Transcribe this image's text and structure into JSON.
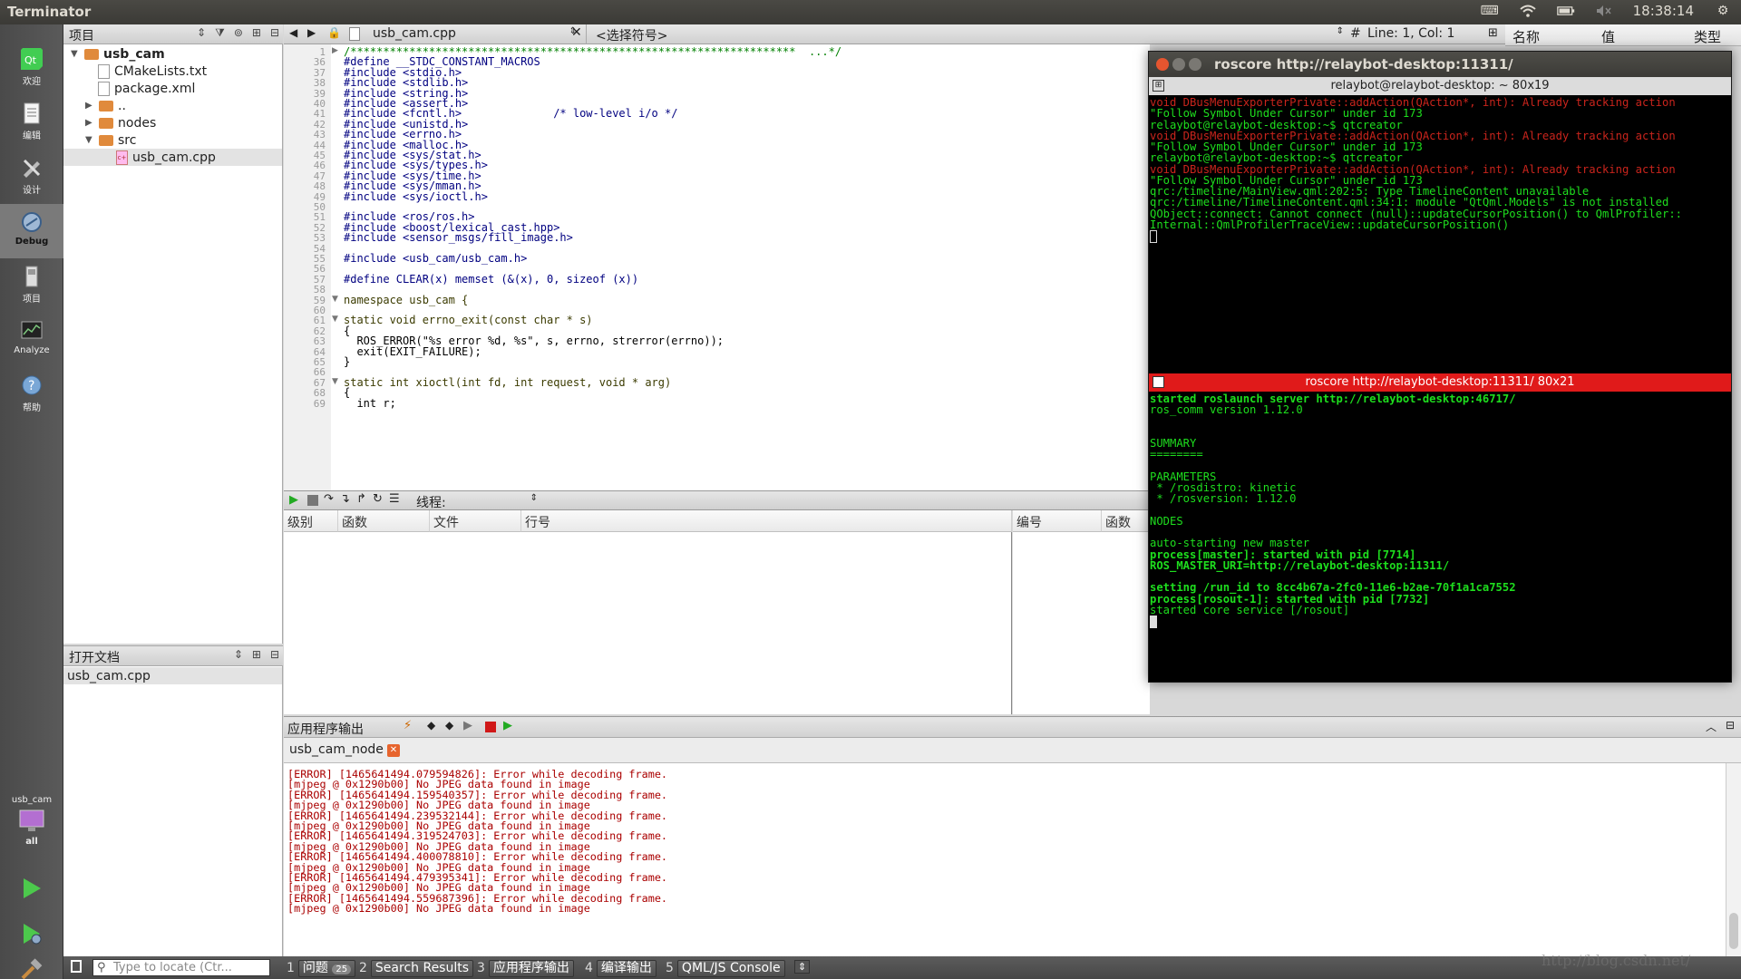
{
  "topbar": {
    "app_title": "Terminator",
    "time": "18:38:14"
  },
  "modebar": {
    "modes": [
      {
        "label": "欢迎"
      },
      {
        "label": "编辑"
      },
      {
        "label": "设计"
      },
      {
        "label": "Debug"
      },
      {
        "label": "项目"
      },
      {
        "label": "Analyze"
      },
      {
        "label": "帮助"
      }
    ],
    "kit_project": "usb_cam",
    "kit_build": "all"
  },
  "project_panel": {
    "title": "项目",
    "tree": [
      {
        "label": "usb_cam"
      },
      {
        "label": "CMakeLists.txt"
      },
      {
        "label": "package.xml"
      },
      {
        "label": ".."
      },
      {
        "label": "nodes"
      },
      {
        "label": "src"
      },
      {
        "label": "usb_cam.cpp"
      }
    ]
  },
  "open_docs": {
    "title": "打开文档",
    "items": [
      "usb_cam.cpp"
    ]
  },
  "editor": {
    "file_name": "usb_cam.cpp",
    "symbol_placeholder": "<选择符号>",
    "cursor_pos": "Line: 1, Col: 1",
    "encoding_mark": "#"
  },
  "code_lines": [
    {
      "n": "1",
      "t": "/********************************************************************  ...*/"
    },
    {
      "n": "36",
      "t": "#define __STDC_CONSTANT_MACROS"
    },
    {
      "n": "37",
      "t": "#include <stdio.h>"
    },
    {
      "n": "38",
      "t": "#include <stdlib.h>"
    },
    {
      "n": "39",
      "t": "#include <string.h>"
    },
    {
      "n": "40",
      "t": "#include <assert.h>"
    },
    {
      "n": "41",
      "t": "#include <fcntl.h>              /* low-level i/o */"
    },
    {
      "n": "42",
      "t": "#include <unistd.h>"
    },
    {
      "n": "43",
      "t": "#include <errno.h>"
    },
    {
      "n": "44",
      "t": "#include <malloc.h>"
    },
    {
      "n": "45",
      "t": "#include <sys/stat.h>"
    },
    {
      "n": "46",
      "t": "#include <sys/types.h>"
    },
    {
      "n": "47",
      "t": "#include <sys/time.h>"
    },
    {
      "n": "48",
      "t": "#include <sys/mman.h>"
    },
    {
      "n": "49",
      "t": "#include <sys/ioctl.h>"
    },
    {
      "n": "50",
      "t": ""
    },
    {
      "n": "51",
      "t": "#include <ros/ros.h>"
    },
    {
      "n": "52",
      "t": "#include <boost/lexical_cast.hpp>"
    },
    {
      "n": "53",
      "t": "#include <sensor_msgs/fill_image.h>"
    },
    {
      "n": "54",
      "t": ""
    },
    {
      "n": "55",
      "t": "#include <usb_cam/usb_cam.h>"
    },
    {
      "n": "56",
      "t": ""
    },
    {
      "n": "57",
      "t": "#define CLEAR(x) memset (&(x), 0, sizeof (x))"
    },
    {
      "n": "58",
      "t": ""
    },
    {
      "n": "59",
      "t": "namespace usb_cam {"
    },
    {
      "n": "60",
      "t": ""
    },
    {
      "n": "61",
      "t": "static void errno_exit(const char * s)"
    },
    {
      "n": "62",
      "t": "{"
    },
    {
      "n": "63",
      "t": "  ROS_ERROR(\"%s error %d, %s\", s, errno, strerror(errno));"
    },
    {
      "n": "64",
      "t": "  exit(EXIT_FAILURE);"
    },
    {
      "n": "65",
      "t": "}"
    },
    {
      "n": "66",
      "t": ""
    },
    {
      "n": "67",
      "t": "static int xioctl(int fd, int request, void * arg)"
    },
    {
      "n": "68",
      "t": "{"
    },
    {
      "n": "69",
      "t": "  int r;"
    }
  ],
  "debugger": {
    "thread_label": "线程:",
    "stack_columns": [
      "级别",
      "函数",
      "文件",
      "行号"
    ],
    "bp_columns": [
      "编号",
      "函数"
    ]
  },
  "locals": {
    "columns": [
      "名称",
      "值",
      "类型"
    ]
  },
  "output": {
    "title": "应用程序输出",
    "tab": "usb_cam_node",
    "lines": [
      "[ERROR] [1465641494.079594826]: Error while decoding frame.",
      "[mjpeg @ 0x1290b00] No JPEG data found in image",
      "[ERROR] [1465641494.159540357]: Error while decoding frame.",
      "[mjpeg @ 0x1290b00] No JPEG data found in image",
      "[ERROR] [1465641494.239532144]: Error while decoding frame.",
      "[mjpeg @ 0x1290b00] No JPEG data found in image",
      "[ERROR] [1465641494.319524703]: Error while decoding frame.",
      "[mjpeg @ 0x1290b00] No JPEG data found in image",
      "[ERROR] [1465641494.400078810]: Error while decoding frame.",
      "[mjpeg @ 0x1290b00] No JPEG data found in image",
      "[ERROR] [1465641494.479395341]: Error while decoding frame.",
      "[mjpeg @ 0x1290b00] No JPEG data found in image",
      "[ERROR] [1465641494.559687396]: Error while decoding frame.",
      "[mjpeg @ 0x1290b00] No JPEG data found in image"
    ]
  },
  "bottombar": {
    "locate_placeholder": "Type to locate (Ctr...",
    "tabs": [
      {
        "num": "1",
        "label": "问题",
        "badge": "25"
      },
      {
        "num": "2",
        "label": "Search Results"
      },
      {
        "num": "3",
        "label": "应用程序输出"
      },
      {
        "num": "4",
        "label": "编译输出"
      },
      {
        "num": "5",
        "label": "QML/JS Console"
      }
    ]
  },
  "terminal": {
    "window_title": "roscore http://relaybot-desktop:11311/",
    "pane1_title": "relaybot@relaybot-desktop: ~ 80x19",
    "pane1_lines": [
      {
        "t": "void DBusMenuExporterPrivate::addAction(QAction*, int): Already tracking action",
        "c": "red"
      },
      {
        "t": "\"Follow Symbol Under Cursor\" under id 173",
        "c": "green"
      },
      {
        "t": "relaybot@relaybot-desktop:~$ qtcreator",
        "c": "green"
      },
      {
        "t": "void DBusMenuExporterPrivate::addAction(QAction*, int): Already tracking action",
        "c": "red"
      },
      {
        "t": "\"Follow Symbol Under Cursor\" under id 173",
        "c": "green"
      },
      {
        "t": "relaybot@relaybot-desktop:~$ qtcreator",
        "c": "green"
      },
      {
        "t": "void DBusMenuExporterPrivate::addAction(QAction*, int): Already tracking action",
        "c": "red"
      },
      {
        "t": "\"Follow Symbol Under Cursor\" under id 173",
        "c": "green"
      },
      {
        "t": "qrc:/timeline/MainView.qml:202:5: Type TimelineContent unavailable",
        "c": "green"
      },
      {
        "t": "qrc:/timeline/TimelineContent.qml:34:1: module \"QtQml.Models\" is not installed",
        "c": "green"
      },
      {
        "t": "QObject::connect: Cannot connect (null)::updateCursorPosition() to QmlProfiler::",
        "c": "green"
      },
      {
        "t": "Internal::QmlProfilerTraceView::updateCursorPosition()",
        "c": "green"
      }
    ],
    "pane2_title": "roscore http://relaybot-desktop:11311/ 80x21",
    "pane2_lines": [
      {
        "t": "started roslaunch server http://relaybot-desktop:46717/",
        "b": true
      },
      {
        "t": "ros_comm version 1.12.0",
        "b": false
      },
      {
        "t": "",
        "b": false
      },
      {
        "t": "",
        "b": false
      },
      {
        "t": "SUMMARY",
        "b": false
      },
      {
        "t": "========",
        "b": false
      },
      {
        "t": "",
        "b": false
      },
      {
        "t": "PARAMETERS",
        "b": false
      },
      {
        "t": " * /rosdistro: kinetic",
        "b": false
      },
      {
        "t": " * /rosversion: 1.12.0",
        "b": false
      },
      {
        "t": "",
        "b": false
      },
      {
        "t": "NODES",
        "b": false
      },
      {
        "t": "",
        "b": false
      },
      {
        "t": "auto-starting new master",
        "b": false
      },
      {
        "t": "process[master]: started with pid [7714]",
        "b": true
      },
      {
        "t": "ROS_MASTER_URI=http://relaybot-desktop:11311/",
        "b": true
      },
      {
        "t": "",
        "b": false
      },
      {
        "t": "setting /run_id to 8cc4b67a-2fc0-11e6-b2ae-70f1a1ca7552",
        "b": true
      },
      {
        "t": "process[rosout-1]: started with pid [7732]",
        "b": true
      },
      {
        "t": "started core service [/rosout]",
        "b": false
      }
    ]
  },
  "watermark": "http://blog.csdn.net/"
}
